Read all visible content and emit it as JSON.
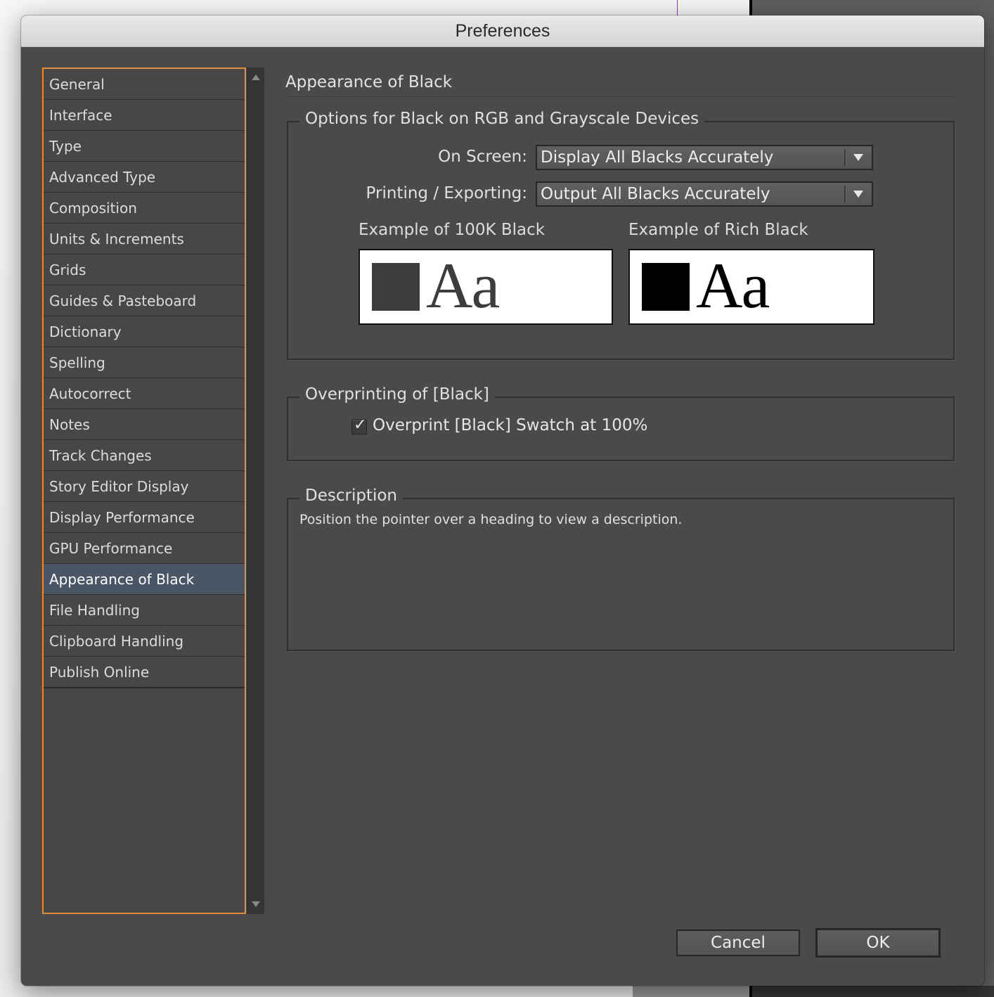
{
  "window": {
    "title": "Preferences"
  },
  "sidebar": {
    "items": [
      {
        "label": "General"
      },
      {
        "label": "Interface"
      },
      {
        "label": "Type"
      },
      {
        "label": "Advanced Type"
      },
      {
        "label": "Composition"
      },
      {
        "label": "Units & Increments"
      },
      {
        "label": "Grids"
      },
      {
        "label": "Guides & Pasteboard"
      },
      {
        "label": "Dictionary"
      },
      {
        "label": "Spelling"
      },
      {
        "label": "Autocorrect"
      },
      {
        "label": "Notes"
      },
      {
        "label": "Track Changes"
      },
      {
        "label": "Story Editor Display"
      },
      {
        "label": "Display Performance"
      },
      {
        "label": "GPU Performance"
      },
      {
        "label": "Appearance of Black"
      },
      {
        "label": "File Handling"
      },
      {
        "label": "Clipboard Handling"
      },
      {
        "label": "Publish Online"
      }
    ],
    "selected": "Appearance of Black"
  },
  "panel": {
    "title": "Appearance of Black",
    "options_group": {
      "legend": "Options for Black on RGB and Grayscale Devices",
      "on_screen": {
        "label": "On Screen:",
        "value": "Display All Blacks Accurately"
      },
      "printing": {
        "label": "Printing / Exporting:",
        "value": "Output All Blacks Accurately"
      },
      "example_100k": {
        "label": "Example of 100K Black",
        "sample_text": "Aa",
        "color": "#3d3d3d"
      },
      "example_rich": {
        "label": "Example of Rich Black",
        "sample_text": "Aa",
        "color": "#000000"
      }
    },
    "overprint_group": {
      "legend": "Overprinting of [Black]",
      "checkbox": {
        "label": "Overprint [Black] Swatch at 100%",
        "checked": true,
        "mark": "✓"
      }
    },
    "description_group": {
      "legend": "Description",
      "text": "Position the pointer over a heading to view a description."
    }
  },
  "buttons": {
    "cancel": "Cancel",
    "ok": "OK"
  },
  "colors": {
    "selection_border": "#e08e3c",
    "selected_item_bg": "#4a5566",
    "dialog_bg": "#4a4a4a"
  }
}
